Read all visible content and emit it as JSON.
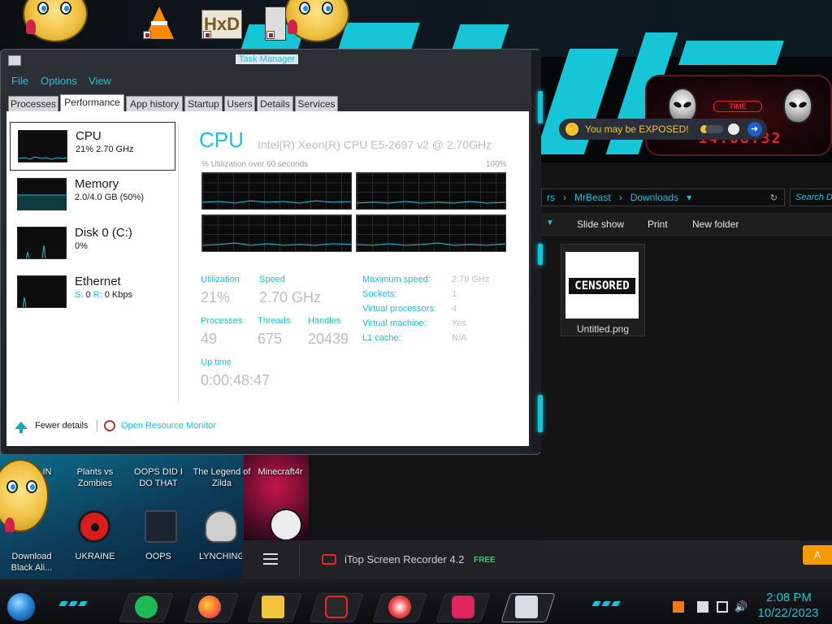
{
  "desktop": {
    "top_icons": [
      "vlc-icon",
      "hxd-icon",
      "tool-icon"
    ],
    "hxd_label": "HxD",
    "icons": [
      {
        "label": "Download Black Ali...",
        "icon": "cartoon-icon"
      },
      {
        "label": "UKRAINE",
        "icon": "radiation-icon"
      },
      {
        "label": "OOPS",
        "icon": "oops-icon"
      },
      {
        "label": "LYNCHING",
        "icon": "lynching-icon"
      },
      {
        "label": "Plants vs Zombies",
        "icon": "pvz-icon"
      },
      {
        "label": "OOPS DID I DO THAT",
        "icon": "oops-did-icon"
      },
      {
        "label": "The Legend of Zilda",
        "icon": "zilda-icon"
      },
      {
        "label": "Minecraft4r",
        "icon": "minecraft-icon"
      }
    ],
    "ukraine_partial": "IN"
  },
  "widget": {
    "time_label": "TIME",
    "time_value": "14:08:32"
  },
  "toast": {
    "text": "You may be EXPOSED!"
  },
  "explorer": {
    "breadcrumb": [
      "rs",
      "MrBeast",
      "Downloads"
    ],
    "search_placeholder": "Search D",
    "toolbar": [
      "Slide show",
      "Print",
      "New folder"
    ],
    "file": {
      "name": "Untitled.png",
      "thumb_text": "CENSORED"
    }
  },
  "task_manager": {
    "title": "Task Manager",
    "menu": [
      "File",
      "Options",
      "View"
    ],
    "tabs": [
      "Processes",
      "Performance",
      "App history",
      "Startup",
      "Users",
      "Details",
      "Services"
    ],
    "active_tab": "Performance",
    "resources": [
      {
        "title": "CPU",
        "sub": "21%  2.70 GHz"
      },
      {
        "title": "Memory",
        "sub": "2.0/4.0 GB (50%)"
      },
      {
        "title": "Disk 0 (C:)",
        "sub": "0%"
      },
      {
        "title": "Ethernet",
        "send_label": "S:",
        "send": "0",
        "recv_label": "R:",
        "recv": "0 Kbps"
      }
    ],
    "cpu": {
      "heading": "CPU",
      "model": "Intel(R) Xeon(R) CPU E5-2697 v2 @ 2.70GHz",
      "graph_label": "% Utilization over 60 seconds",
      "graph_max": "100%",
      "stats": {
        "utilization_label": "Utilization",
        "utilization": "21%",
        "speed_label": "Speed",
        "speed": "2.70 GHz",
        "processes_label": "Processes",
        "processes": "49",
        "threads_label": "Threads",
        "threads": "675",
        "handles_label": "Handles",
        "handles": "20439",
        "uptime_label": "Up time",
        "uptime": "0:00:48:47"
      },
      "specs": [
        {
          "label": "Maximum speed:",
          "value": "2.70 GHz"
        },
        {
          "label": "Sockets:",
          "value": "1"
        },
        {
          "label": "Virtual processors:",
          "value": "4"
        },
        {
          "label": "Virtual machine:",
          "value": "Yes"
        },
        {
          "label": "L1 cache:",
          "value": "N/A"
        }
      ]
    },
    "footer": {
      "fewer_details": "Fewer details",
      "open_monitor": "Open Resource Monitor"
    }
  },
  "recorder": {
    "title": "iTop Screen Recorder 4.2",
    "badge": "FREE",
    "button": "A"
  },
  "taskbar": {
    "apps": [
      "start-orb",
      "spotify-icon",
      "firefox-icon",
      "file-explorer-icon",
      "itop-recorder-icon",
      "paint-icon",
      "sparkle-app-icon",
      "task-manager-icon"
    ],
    "clock_time": "2:08 PM",
    "clock_date": "10/22/2023"
  },
  "colors": {
    "accent": "#17c3d8",
    "frame": "#2d3136",
    "toast_text": "#f3c33b",
    "recorder_button": "#f59a00"
  }
}
